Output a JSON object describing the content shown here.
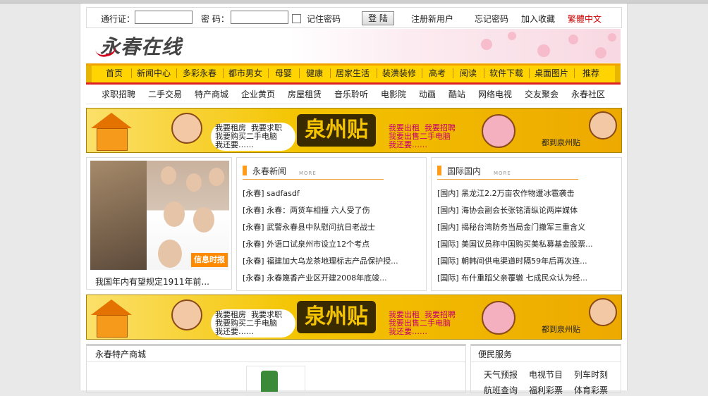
{
  "login": {
    "user_label": "通行证：",
    "pass_label": "密  码：",
    "remember_label": "记住密码",
    "login_button": "登 陆",
    "register_link": "注册新用户",
    "forgot_link": "忘记密码",
    "favorite_link": "加入收藏",
    "traditional_link": "繁體中文"
  },
  "header": {
    "logo_text": "永春在线"
  },
  "colors": {
    "nav_bg": "#ffd400",
    "nav_bottom": "#dd2222",
    "traditional_link": "#cc0000",
    "section_accent": "#ff9c1a"
  },
  "nav": {
    "items": [
      "首页",
      "新闻中心",
      "多彩永春",
      "都市男女",
      "母婴",
      "健康",
      "居家生活",
      "装潢装修",
      "高考",
      "阅读",
      "软件下载",
      "桌面图片",
      "推荐"
    ]
  },
  "subnav": {
    "items": [
      "求职招聘",
      "二手交易",
      "特产商城",
      "企业黄页",
      "房屋租赁",
      "音乐聆听",
      "电影院",
      "动画",
      "酷站",
      "网络电视",
      "交友聚会",
      "永春社区"
    ]
  },
  "banner": {
    "left_text": "我要租房  我要求职\n我要购买二手电脑\n我还要……",
    "center_text": "泉州贴",
    "right_text": "我要出租  我要招聘\n我要出售二手电脑\n我还要……",
    "go_text": "都到泉州贴"
  },
  "photo": {
    "caption": "我国年内有望规定1911年前...",
    "tag": "信息时报"
  },
  "yongchun_news": {
    "title": "永春新闻",
    "more": "MORE",
    "items": [
      "[永春] sadfasdf",
      "[永春] 永春：两货车相撞 六人受了伤",
      "[永春] 武警永春县中队慰问抗日老战士",
      "[永春] 外语口试泉州市设立12个考点",
      "[永春] 福建加大乌龙茶地理标志产品保护授...",
      "[永春] 永春篾香产业区开建2008年底竣..."
    ]
  },
  "intl_news": {
    "title": "国际国内",
    "more": "MORE",
    "items": [
      "[国内] 黑龙江2.2万亩农作物遭冰雹袭击",
      "[国内] 海协会副会长张铭清纵论两岸媒体",
      "[国内] 揭秘台湾防务当局金门撤军三重含义",
      "[国际] 美国议员称中国购买美私募基金股票...",
      "[国际] 朝韩间供电渠道时隔59年后再次连...",
      "[国际] 布什重蹈父亲覆辙 七成民众认为经..."
    ]
  },
  "shop": {
    "title": "永春特产商城"
  },
  "services": {
    "title": "便民服务",
    "items": [
      "天气预报",
      "电视节目",
      "列车时刻",
      "航班查询",
      "福利彩票",
      "体育彩票"
    ]
  }
}
